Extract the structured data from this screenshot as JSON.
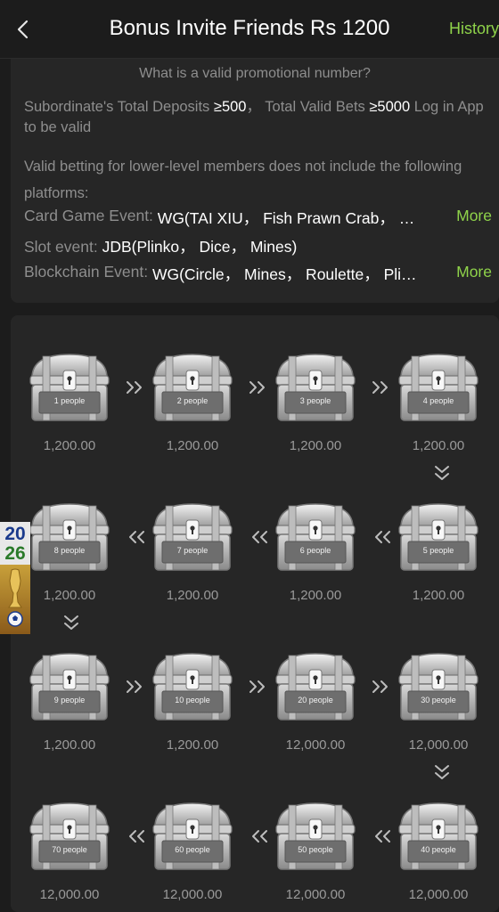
{
  "header": {
    "title": "Bonus Invite Friends Rs 1200",
    "history_label": "History"
  },
  "info": {
    "question": "What is a valid promotional number?",
    "req_prefix": "Subordinate's Total Deposits ",
    "req_deposit": "≥500",
    "req_mid": "， Total Valid Bets ",
    "req_bets": "≥5000",
    "req_suffix": " Log in App to be valid",
    "note": "Valid betting for lower-level members does not include the following platforms:",
    "lines": [
      {
        "label": "Card Game Event: ",
        "value": "WG(TAI XIU， Fish Prawn Crab， Ba...",
        "more": "More"
      },
      {
        "label": "Slot event: ",
        "value": "JDB(Plinko， Dice， Mines)",
        "more": ""
      },
      {
        "label": "Blockchain Event: ",
        "value": "WG(Circle， Mines， Roulette， Plink...",
        "more": "More"
      }
    ]
  },
  "rewards": [
    {
      "people": "1 people",
      "amount": "1,200.00"
    },
    {
      "people": "2 people",
      "amount": "1,200.00"
    },
    {
      "people": "3 people",
      "amount": "1,200.00"
    },
    {
      "people": "4 people",
      "amount": "1,200.00"
    },
    {
      "people": "5 people",
      "amount": "1,200.00"
    },
    {
      "people": "6 people",
      "amount": "1,200.00"
    },
    {
      "people": "7 people",
      "amount": "1,200.00"
    },
    {
      "people": "8 people",
      "amount": "1,200.00"
    },
    {
      "people": "9 people",
      "amount": "1,200.00"
    },
    {
      "people": "10 people",
      "amount": "1,200.00"
    },
    {
      "people": "20 people",
      "amount": "12,000.00"
    },
    {
      "people": "30 people",
      "amount": "12,000.00"
    },
    {
      "people": "40 people",
      "amount": "12,000.00"
    },
    {
      "people": "50 people",
      "amount": "12,000.00"
    },
    {
      "people": "60 people",
      "amount": "12,000.00"
    },
    {
      "people": "70 people",
      "amount": "12,000.00"
    }
  ],
  "banner": {
    "year_top": "20",
    "year_bottom": "26"
  },
  "colors": {
    "accent": "#8fd34a",
    "background": "#1c1c1c",
    "card": "#262626",
    "muted": "#8e8e8e"
  },
  "icons": {
    "back": "chevron-left-icon",
    "chest": "treasure-chest-icon",
    "arrow": "double-chevron-icon"
  }
}
